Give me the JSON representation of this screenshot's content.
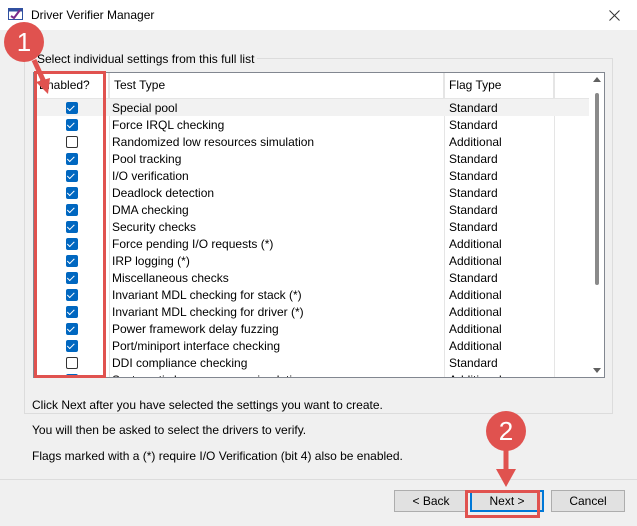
{
  "window": {
    "title": "Driver Verifier Manager",
    "close_icon": "close-icon",
    "app_icon": "driver-verifier-icon"
  },
  "group": {
    "label": "Select individual settings from this full list"
  },
  "list": {
    "columns": [
      "Enabled?",
      "Test Type",
      "Flag Type"
    ],
    "rows": [
      {
        "enabled": true,
        "test": "Special pool",
        "flag": "Standard"
      },
      {
        "enabled": true,
        "test": "Force IRQL checking",
        "flag": "Standard"
      },
      {
        "enabled": false,
        "test": "Randomized low resources simulation",
        "flag": "Additional"
      },
      {
        "enabled": true,
        "test": "Pool tracking",
        "flag": "Standard"
      },
      {
        "enabled": true,
        "test": "I/O verification",
        "flag": "Standard"
      },
      {
        "enabled": true,
        "test": "Deadlock detection",
        "flag": "Standard"
      },
      {
        "enabled": true,
        "test": "DMA checking",
        "flag": "Standard"
      },
      {
        "enabled": true,
        "test": "Security checks",
        "flag": "Standard"
      },
      {
        "enabled": true,
        "test": "Force pending I/O requests (*)",
        "flag": "Additional"
      },
      {
        "enabled": true,
        "test": "IRP logging (*)",
        "flag": "Additional"
      },
      {
        "enabled": true,
        "test": "Miscellaneous checks",
        "flag": "Standard"
      },
      {
        "enabled": true,
        "test": "Invariant MDL checking for stack (*)",
        "flag": "Additional"
      },
      {
        "enabled": true,
        "test": "Invariant MDL checking for driver (*)",
        "flag": "Additional"
      },
      {
        "enabled": true,
        "test": "Power framework delay fuzzing",
        "flag": "Additional"
      },
      {
        "enabled": true,
        "test": "Port/miniport interface checking",
        "flag": "Additional"
      },
      {
        "enabled": false,
        "test": "DDI compliance checking",
        "flag": "Standard"
      },
      {
        "enabled": true,
        "test": "Systematic low resources simulation",
        "flag": "Additional"
      }
    ]
  },
  "info": {
    "line1": "Click Next after you have selected the settings you want to create.",
    "line2": "You will then be asked to select the drivers to verify.",
    "line3": "Flags marked with a (*) require I/O Verification (bit 4) also be enabled."
  },
  "buttons": {
    "back": "< Back",
    "next": "Next >",
    "cancel": "Cancel"
  },
  "annotations": {
    "badge1": "1",
    "badge2": "2",
    "color": "#e0524f"
  }
}
